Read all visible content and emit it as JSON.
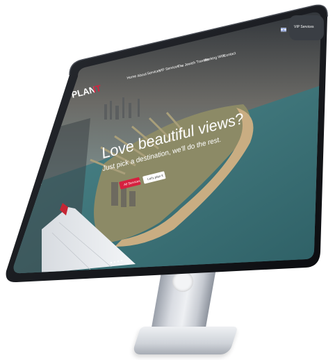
{
  "brand": {
    "logo_main": "PLAN",
    "logo_accent": "IT"
  },
  "nav": {
    "items": [
      {
        "label": "Home"
      },
      {
        "label": "About"
      },
      {
        "label": "Services"
      },
      {
        "label": "VIP Services ⌄"
      },
      {
        "label": "The Jewish Traveler"
      },
      {
        "label": "Working With"
      },
      {
        "label": "Contact"
      }
    ],
    "vip_button_label": "VIP Services"
  },
  "hero": {
    "title": "Love beautiful views?",
    "subtitle": "Just pick a destination, we'll do the rest.",
    "primary_button": "All Services",
    "secondary_button": "Let's plan it"
  },
  "colors": {
    "accent": "#d6213f",
    "bezel": "#111318",
    "sea": "#4f8a8e",
    "sand": "#c9ad82"
  },
  "icons": {
    "flag": "israel-flag-icon"
  }
}
